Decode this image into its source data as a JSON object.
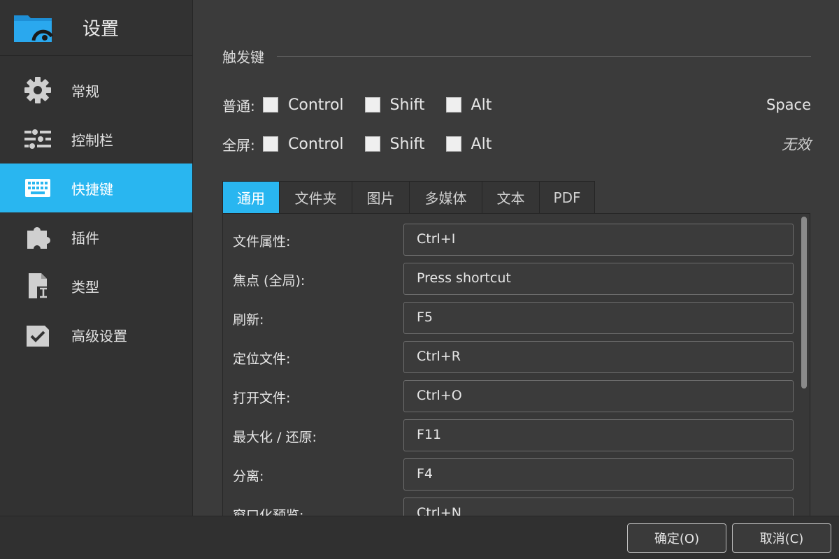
{
  "app": {
    "title": "设置"
  },
  "sidebar": {
    "items": [
      {
        "label": "常规",
        "icon": "gear-icon",
        "active": false
      },
      {
        "label": "控制栏",
        "icon": "sliders-icon",
        "active": false
      },
      {
        "label": "快捷键",
        "icon": "keyboard-icon",
        "active": true
      },
      {
        "label": "插件",
        "icon": "puzzle-icon",
        "active": false
      },
      {
        "label": "类型",
        "icon": "file-type-icon",
        "active": false
      },
      {
        "label": "高级设置",
        "icon": "checkbox-icon",
        "active": false
      }
    ]
  },
  "trigger": {
    "title": "触发键",
    "normal": {
      "label": "普通:",
      "control": "Control",
      "shift": "Shift",
      "alt": "Alt",
      "key": "Space"
    },
    "fullscreen": {
      "label": "全屏:",
      "control": "Control",
      "shift": "Shift",
      "alt": "Alt",
      "key": "无效"
    }
  },
  "tabs": [
    {
      "label": "通用",
      "active": true
    },
    {
      "label": "文件夹",
      "active": false
    },
    {
      "label": "图片",
      "active": false
    },
    {
      "label": "多媒体",
      "active": false
    },
    {
      "label": "文本",
      "active": false
    },
    {
      "label": "PDF",
      "active": false
    }
  ],
  "shortcuts": [
    {
      "label": "文件属性:",
      "value": "Ctrl+I"
    },
    {
      "label": "焦点 (全局):",
      "value": "Press shortcut"
    },
    {
      "label": "刷新:",
      "value": "F5"
    },
    {
      "label": "定位文件:",
      "value": "Ctrl+R"
    },
    {
      "label": "打开文件:",
      "value": "Ctrl+O"
    },
    {
      "label": "最大化 / 还原:",
      "value": "F11"
    },
    {
      "label": "分离:",
      "value": "F4"
    },
    {
      "label": "窗口化预览:",
      "value": "Ctrl+N"
    }
  ],
  "footer": {
    "ok_label": "确定(O)",
    "cancel_label": "取消(C)"
  },
  "colors": {
    "accent": "#29b6f0",
    "background": "#3b3b3b",
    "sidebar": "#323232"
  }
}
